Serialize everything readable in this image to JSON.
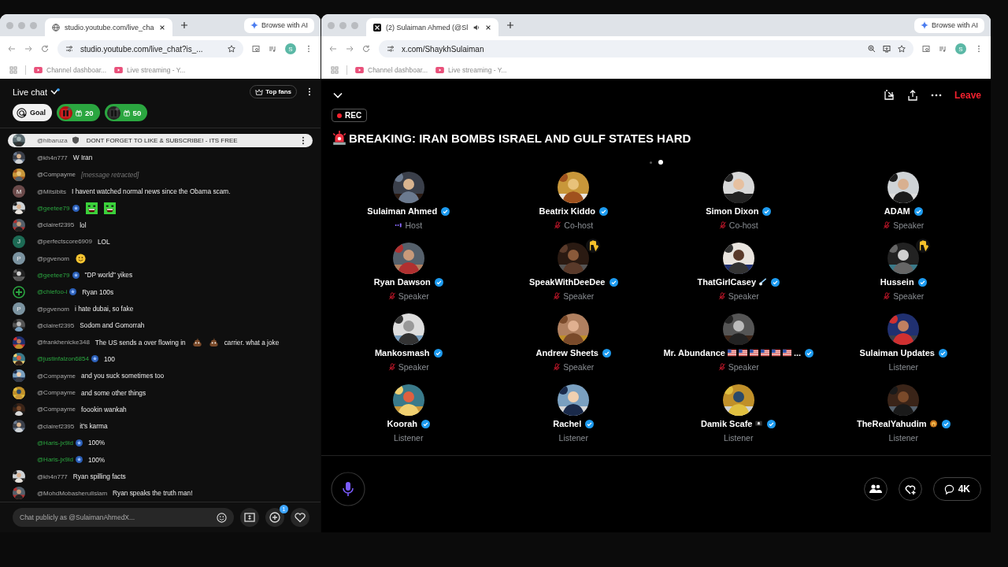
{
  "chat_window": {
    "browser": {
      "tab_title": "studio.youtube.com/live_cha",
      "url": "studio.youtube.com/live_chat?is_...",
      "browse_ai": "Browse with AI",
      "profile": "S",
      "bookmarks": [
        "Channel dashboar...",
        "Live streaming - Y..."
      ]
    },
    "chat": {
      "title": "Live chat",
      "top_fans": "Top fans",
      "goal": "Goal",
      "chips": [
        {
          "count": "20"
        },
        {
          "count": "50"
        }
      ],
      "pinned": {
        "user": "@hibaruza",
        "text": "DONT FORGET TO LIKE & SUBSCRIBE! - ITS FREE"
      },
      "messages": [
        {
          "user": "@kh4n777",
          "member": false,
          "text": "W Iran"
        },
        {
          "user": "@Compayme",
          "member": false,
          "retracted": true,
          "text": "[message retracted]"
        },
        {
          "kind": "letter",
          "letter": "M",
          "color": "#6b4a4a",
          "user": "@Mitsibits",
          "member": false,
          "text": "I havent watched normal news since the Obama scam."
        },
        {
          "user": "@geetee79",
          "member": true,
          "parts": [
            {
              "kind": "emote"
            },
            {
              "kind": "emote"
            }
          ]
        },
        {
          "user": "@clairef2395",
          "member": false,
          "text": "lol"
        },
        {
          "kind": "letter",
          "letter": "J",
          "color": "#1d6b55",
          "user": "@perfectscore6909",
          "member": false,
          "text": "LOL"
        },
        {
          "kind": "letter",
          "letter": "P",
          "color": "#7b93a0",
          "user": "@pgvenom",
          "member": false,
          "parts": [
            {
              "kind": "smiley"
            }
          ]
        },
        {
          "user": "@geetee79",
          "member": true,
          "text": "\"DP world\" yikes"
        },
        {
          "kind": "plus",
          "user": "@chiefoo-i",
          "member": true,
          "text": "Ryan 100s"
        },
        {
          "kind": "letter",
          "letter": "P",
          "color": "#7b93a0",
          "user": "@pgvenom",
          "member": false,
          "text": "i hate dubai, so fake"
        },
        {
          "user": "@clairef2395",
          "member": false,
          "text": "Sodom and Gomorrah"
        },
        {
          "user": "@frankhenicke348",
          "member": false,
          "parts": [
            {
              "kind": "text",
              "text": "The US sends a over flowing in"
            },
            {
              "kind": "poop"
            },
            {
              "kind": "poop"
            },
            {
              "kind": "text",
              "text": "carrier. what a joke"
            }
          ]
        },
        {
          "user": "@justinfalzon6854",
          "member": true,
          "text": "100"
        },
        {
          "user": "@Compayme",
          "member": false,
          "text": "and you suck sometimes too"
        },
        {
          "user": "@Compayme",
          "member": false,
          "text": "and some other things"
        },
        {
          "user": "@Compayme",
          "member": false,
          "text": "foookin wankah"
        },
        {
          "user": "@clairef2395",
          "member": false,
          "text": "it's karma"
        },
        {
          "kind": "blank",
          "user": "@Haris-jx9ld",
          "member": true,
          "text": "100%"
        },
        {
          "kind": "blank",
          "user": "@Haris-jx9ld",
          "member": true,
          "text": "100%"
        },
        {
          "user": "@kh4n777",
          "member": false,
          "text": "Ryan spilling facts"
        },
        {
          "user": "@MohdMobasherulIslam",
          "member": false,
          "text": "Ryan speaks the truth man!"
        }
      ],
      "input": {
        "placeholder": "Chat publicly as @SulaimanAhmedX...",
        "notification_count": "1"
      }
    }
  },
  "space_window": {
    "browser": {
      "tab_title": "(2) Sulaiman Ahmed (@Sl",
      "url": "x.com/ShaykhSulaiman",
      "browse_ai": "Browse with AI",
      "profile": "S",
      "bookmarks": [
        "Channel dashboar...",
        "Live streaming - Y..."
      ]
    },
    "space": {
      "leave": "Leave",
      "rec": "REC",
      "title": "BREAKING: IRAN BOMBS ISRAEL AND GULF STATES HARD",
      "pages": [
        {
          "selected": false
        },
        {
          "selected": true
        }
      ],
      "participants": [
        {
          "kind": "talking",
          "name": "Sulaiman Ahmed",
          "verified": true,
          "hand_raised": false,
          "role": "Host"
        },
        {
          "kind": "muted",
          "name": "Beatrix Kiddo",
          "verified": true,
          "hand_raised": false,
          "role": "Co-host"
        },
        {
          "kind": "muted",
          "name": "Simon Dixon",
          "verified": true,
          "hand_raised": false,
          "role": "Co-host"
        },
        {
          "kind": "muted",
          "name": "ADAM",
          "verified": true,
          "hand_raised": false,
          "role": "Speaker"
        },
        {
          "kind": "muted",
          "name": "Ryan Dawson",
          "verified": true,
          "hand_raised": false,
          "role": "Speaker"
        },
        {
          "kind": "muted",
          "name": "SpeakWithDeeDee",
          "verified": true,
          "hand_raised": true,
          "role": "Speaker"
        },
        {
          "kind": "muted",
          "name": "ThatGirlCasey",
          "emojis": [
            {
              "kind": "comet"
            }
          ],
          "verified": true,
          "hand_raised": false,
          "role": "Speaker"
        },
        {
          "kind": "muted",
          "name": "Hussein",
          "verified": true,
          "hand_raised": true,
          "role": "Speaker"
        },
        {
          "kind": "muted",
          "name": "Mankosmash",
          "verified": true,
          "hand_raised": false,
          "role": "Speaker"
        },
        {
          "kind": "muted",
          "name": "Andrew Sheets",
          "verified": true,
          "hand_raised": false,
          "role": "Speaker"
        },
        {
          "kind": "muted",
          "name": "Mr. Abundance",
          "emojis": [
            {
              "kind": "flag"
            },
            {
              "kind": "flag"
            },
            {
              "kind": "flag"
            },
            {
              "kind": "flag"
            },
            {
              "kind": "flag"
            },
            {
              "kind": "flag"
            }
          ],
          "ellipsis": "...",
          "verified": true,
          "hand_raised": false,
          "role": "Speaker"
        },
        {
          "kind": "listener",
          "name": "Sulaiman Updates",
          "verified": true,
          "hand_raised": false,
          "role": "Listener"
        },
        {
          "kind": "listener",
          "name": "Koorah",
          "verified": true,
          "hand_raised": false,
          "role": "Listener"
        },
        {
          "kind": "listener",
          "name": "Rachel",
          "verified": true,
          "hand_raised": false,
          "role": "Listener"
        },
        {
          "kind": "listener",
          "name": "Damik Scafe",
          "emojis": [
            {
              "kind": "pirate-flag"
            }
          ],
          "verified": true,
          "hand_raised": false,
          "role": "Listener"
        },
        {
          "kind": "listener",
          "name": "TheRealYahudim",
          "emojis": [
            {
              "kind": "lion"
            }
          ],
          "verified": true,
          "hand_raised": false,
          "role": "Listener"
        }
      ],
      "comments": "4K"
    }
  }
}
